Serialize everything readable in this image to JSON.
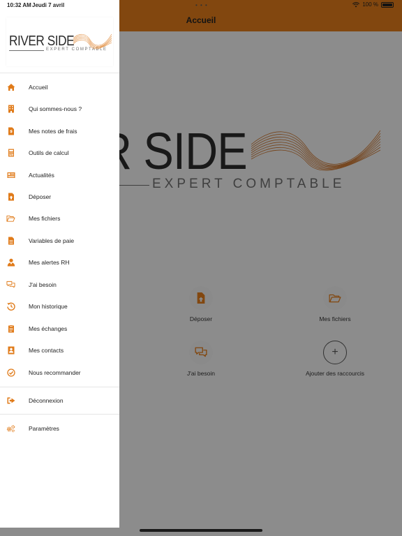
{
  "status_bar": {
    "time": "10:32 AM",
    "date": "Jeudi 7 avril",
    "battery": "100 %",
    "dots": "• • •"
  },
  "header": {
    "title": "Accueil"
  },
  "logo": {
    "brand": "RIVER SIDE",
    "tagline": "EXPERT COMPTABLE"
  },
  "background_logo": {
    "brand": "R SIDE",
    "tagline": "EXPERT COMPTABLE"
  },
  "shortcuts": [
    {
      "label": "Déposer",
      "icon": "file-upload-icon"
    },
    {
      "label": "Mes fichiers",
      "icon": "folder-open-icon"
    },
    {
      "label": "J'ai besoin",
      "icon": "chat-bubbles-icon"
    },
    {
      "label": "Ajouter des raccourcis",
      "icon": "plus-icon"
    }
  ],
  "menu": {
    "items": [
      {
        "label": "Accueil",
        "icon": "home-icon"
      },
      {
        "label": "Qui sommes-nous ?",
        "icon": "building-icon"
      },
      {
        "label": "Mes notes de frais",
        "icon": "receipt-icon"
      },
      {
        "label": "Outils de calcul",
        "icon": "calculator-icon"
      },
      {
        "label": "Actualités",
        "icon": "newspaper-icon"
      },
      {
        "label": "Déposer",
        "icon": "file-upload-icon"
      },
      {
        "label": "Mes fichiers",
        "icon": "folder-open-icon"
      },
      {
        "label": "Variables de paie",
        "icon": "document-icon"
      },
      {
        "label": "Mes alertes RH",
        "icon": "user-tie-icon"
      },
      {
        "label": "J'ai besoin",
        "icon": "chat-bubbles-icon"
      },
      {
        "label": "Mon historique",
        "icon": "history-icon"
      },
      {
        "label": "Mes échanges",
        "icon": "clipboard-icon"
      },
      {
        "label": "Mes contacts",
        "icon": "contact-card-icon"
      },
      {
        "label": "Nous recommander",
        "icon": "check-circle-icon"
      }
    ],
    "logout": {
      "label": "Déconnexion",
      "icon": "sign-out-icon"
    },
    "settings": {
      "label": "Paramètres",
      "icon": "cogs-icon"
    }
  },
  "colors": {
    "accent": "#e07b1a",
    "drawer_bg": "#ffffff",
    "overlay": "rgba(0,0,0,0.42)"
  }
}
